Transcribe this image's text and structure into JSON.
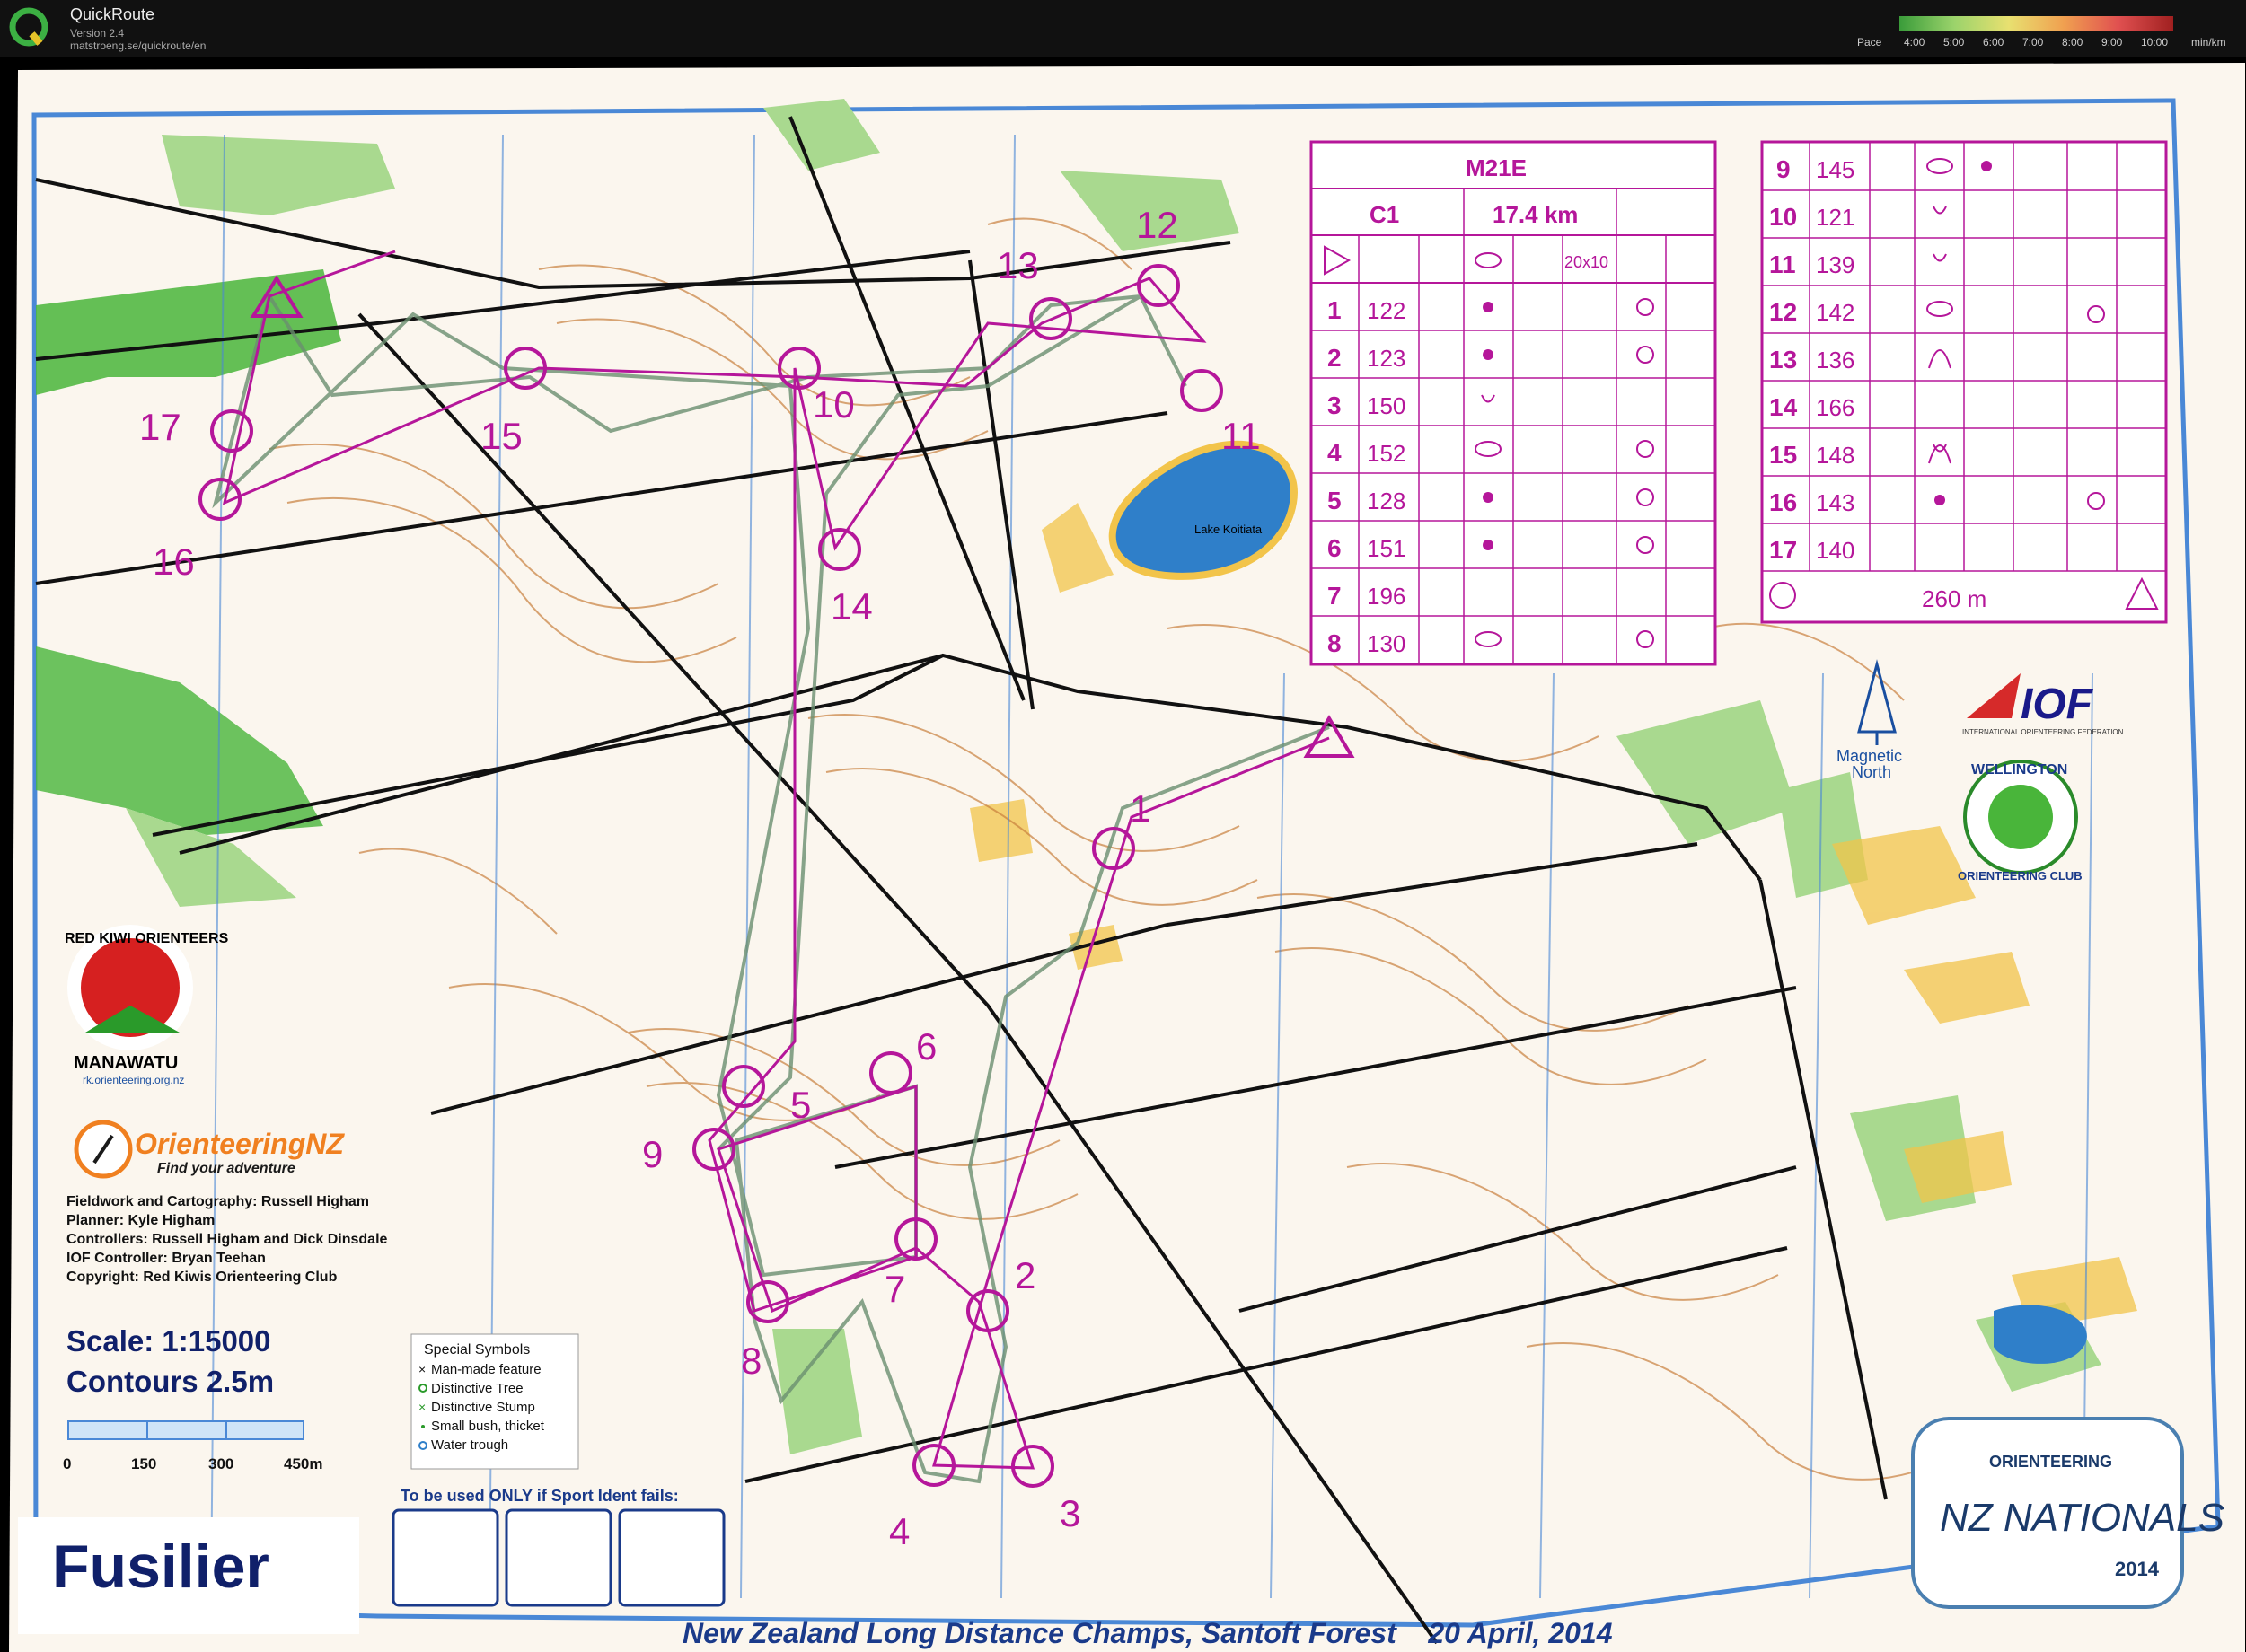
{
  "app": {
    "name": "QuickRoute",
    "version": "Version 2.4",
    "url": "matstroeng.se/quickroute/en",
    "pace_label": "Pace",
    "pace_ticks": [
      "4:00",
      "5:00",
      "6:00",
      "7:00",
      "8:00",
      "9:00",
      "10:00"
    ],
    "pace_unit": "min/km"
  },
  "map": {
    "title": "Fusilier",
    "footer": "New Zealand Long Distance Champs, Santoft Forest    20 April, 2014",
    "lake_label": "Lake Koitiata",
    "scale": "Scale: 1:15000",
    "contours": "Contours  2.5m",
    "scale_ticks": [
      "0",
      "150",
      "300",
      "450m"
    ],
    "credits": [
      "Fieldwork and Cartography: Russell Higham",
      "Planner: Kyle Higham",
      "Controllers: Russell Higham and Dick Dinsdale",
      "IOF Controller: Bryan Teehan",
      "Copyright: Red Kiwis Orienteering Club"
    ],
    "special_symbols_title": "Special Symbols",
    "special_symbols": [
      "Man-made feature",
      "Distinctive Tree",
      "Distinctive Stump",
      "Small bush, thicket",
      "Water trough"
    ],
    "sport_ident_label": "To be used ONLY if Sport Ident fails:",
    "magnetic_north": [
      "Magnetic",
      "North"
    ],
    "logo_rko": {
      "ring": "RED KIWI ORIENTEERS",
      "region": "MANAWATU",
      "url": "rk.orienteering.org.nz"
    },
    "logo_onz": {
      "name": "OrienteeringNZ",
      "tagline": "Find your adventure"
    },
    "logo_iof": {
      "mark": "IOF",
      "sub": "INTERNATIONAL ORIENTEERING FEDERATION"
    },
    "logo_wellington": {
      "top": "WELLINGTON",
      "bottom": "ORIENTEERING CLUB"
    },
    "logo_nationals": {
      "top": "ORIENTEERING",
      "mid": "NZ NATIONALS",
      "year": "2014"
    },
    "control_numbers": [
      "1",
      "2",
      "3",
      "4",
      "5",
      "6",
      "7",
      "8",
      "9",
      "10",
      "11",
      "12",
      "13",
      "14",
      "15",
      "16",
      "17"
    ]
  },
  "description_sheet": {
    "class": "M21E",
    "course": "C1",
    "length": "17.4 km",
    "start_note": "20x10",
    "rows_left": [
      {
        "n": "1",
        "code": "122"
      },
      {
        "n": "2",
        "code": "123"
      },
      {
        "n": "3",
        "code": "150"
      },
      {
        "n": "4",
        "code": "152"
      },
      {
        "n": "5",
        "code": "128"
      },
      {
        "n": "6",
        "code": "151"
      },
      {
        "n": "7",
        "code": "196"
      },
      {
        "n": "8",
        "code": "130"
      }
    ],
    "rows_right": [
      {
        "n": "9",
        "code": "145"
      },
      {
        "n": "10",
        "code": "121"
      },
      {
        "n": "11",
        "code": "139"
      },
      {
        "n": "12",
        "code": "142"
      },
      {
        "n": "13",
        "code": "136"
      },
      {
        "n": "14",
        "code": "166"
      },
      {
        "n": "15",
        "code": "148"
      },
      {
        "n": "16",
        "code": "143"
      },
      {
        "n": "17",
        "code": "140"
      }
    ],
    "finish_distance": "260 m"
  },
  "colors": {
    "paper": "#fbf6ee",
    "contour": "#c9803e",
    "purple": "#b5169a",
    "green": "#49b53a",
    "lightgreen": "#a9d98f",
    "yellow": "#f2c44a",
    "water": "#2f7fc9",
    "border_blue": "#4a88d6",
    "route": "#6a8f6f"
  }
}
